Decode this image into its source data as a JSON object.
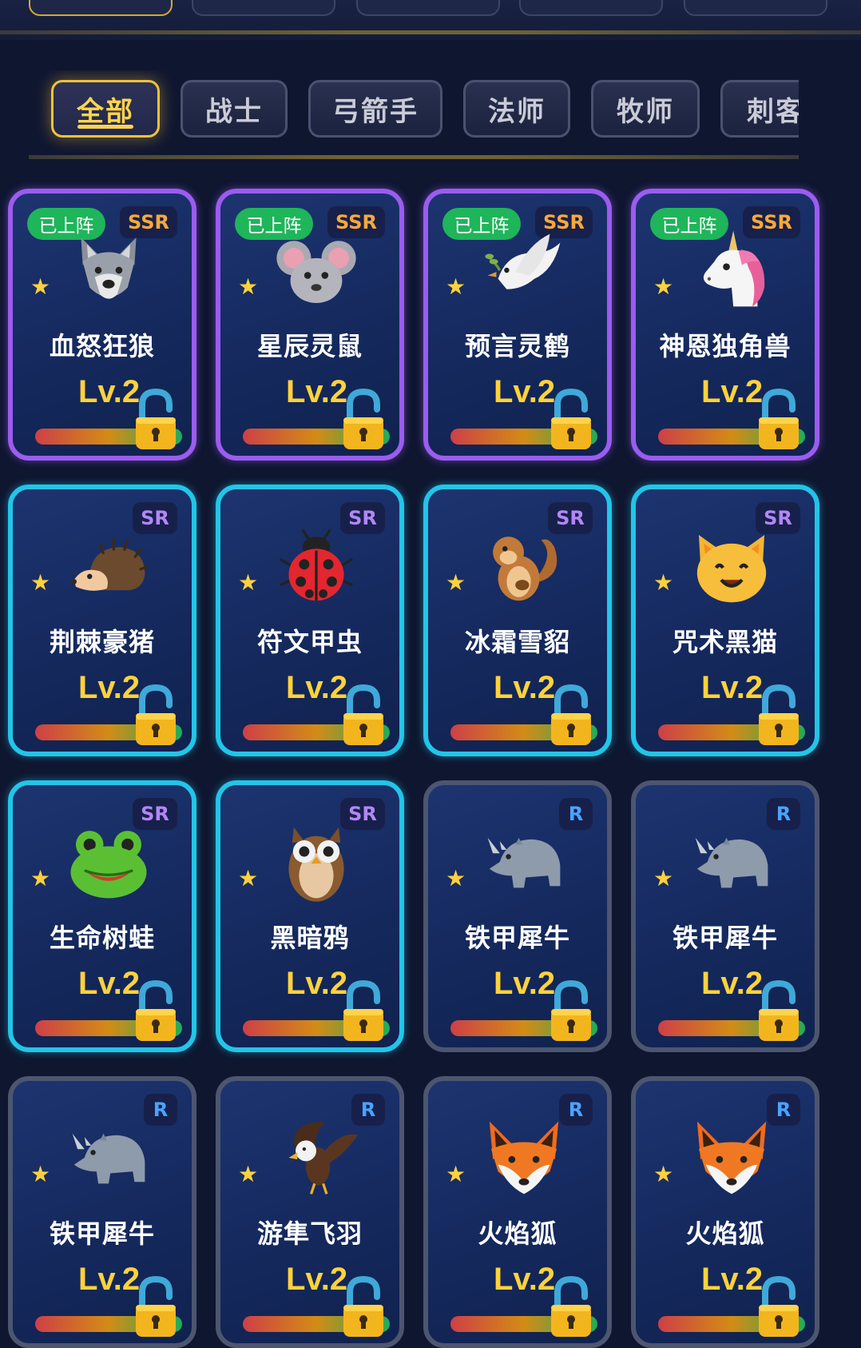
{
  "tabs": [
    {
      "label": "全部",
      "active": true
    },
    {
      "label": "战士",
      "active": false
    },
    {
      "label": "弓箭手",
      "active": false
    },
    {
      "label": "法师",
      "active": false
    },
    {
      "label": "牧师",
      "active": false
    },
    {
      "label": "刺客",
      "active": false
    }
  ],
  "cards": [
    {
      "name": "血怒狂狼",
      "rarity": "SSR",
      "deployed": "已上阵",
      "level": "Lv.2",
      "icon": "wolf-icon"
    },
    {
      "name": "星辰灵鼠",
      "rarity": "SSR",
      "deployed": "已上阵",
      "level": "Lv.2",
      "icon": "mouse-icon"
    },
    {
      "name": "预言灵鹤",
      "rarity": "SSR",
      "deployed": "已上阵",
      "level": "Lv.2",
      "icon": "dove-icon"
    },
    {
      "name": "神恩独角兽",
      "rarity": "SSR",
      "deployed": "已上阵",
      "level": "Lv.2",
      "icon": "unicorn-icon"
    },
    {
      "name": "荆棘豪猪",
      "rarity": "SR",
      "level": "Lv.2",
      "icon": "hedgehog-icon"
    },
    {
      "name": "符文甲虫",
      "rarity": "SR",
      "level": "Lv.2",
      "icon": "ladybug-icon"
    },
    {
      "name": "冰霜雪貂",
      "rarity": "SR",
      "level": "Lv.2",
      "icon": "chipmunk-icon"
    },
    {
      "name": "咒术黑猫",
      "rarity": "SR",
      "level": "Lv.2",
      "icon": "cat-icon"
    },
    {
      "name": "生命树蛙",
      "rarity": "SR",
      "level": "Lv.2",
      "icon": "frog-icon"
    },
    {
      "name": "黑暗鸦",
      "rarity": "SR",
      "level": "Lv.2",
      "icon": "owl-icon"
    },
    {
      "name": "铁甲犀牛",
      "rarity": "R",
      "level": "Lv.2",
      "icon": "rhino-icon"
    },
    {
      "name": "铁甲犀牛",
      "rarity": "R",
      "level": "Lv.2",
      "icon": "rhino-icon"
    },
    {
      "name": "铁甲犀牛",
      "rarity": "R",
      "level": "Lv.2",
      "icon": "rhino-icon"
    },
    {
      "name": "游隼飞羽",
      "rarity": "R",
      "level": "Lv.2",
      "icon": "eagle-icon"
    },
    {
      "name": "火焰狐",
      "rarity": "R",
      "level": "Lv.2",
      "icon": "fox-icon"
    },
    {
      "name": "火焰狐",
      "rarity": "R",
      "level": "Lv.2",
      "icon": "fox-icon"
    }
  ],
  "colors": {
    "ssr_border": "#9b5cf0",
    "sr_border": "#22c5e8",
    "r_border": "#4c5670",
    "accent_gold": "#ffd23c",
    "deployed_green": "#1fb55a"
  }
}
